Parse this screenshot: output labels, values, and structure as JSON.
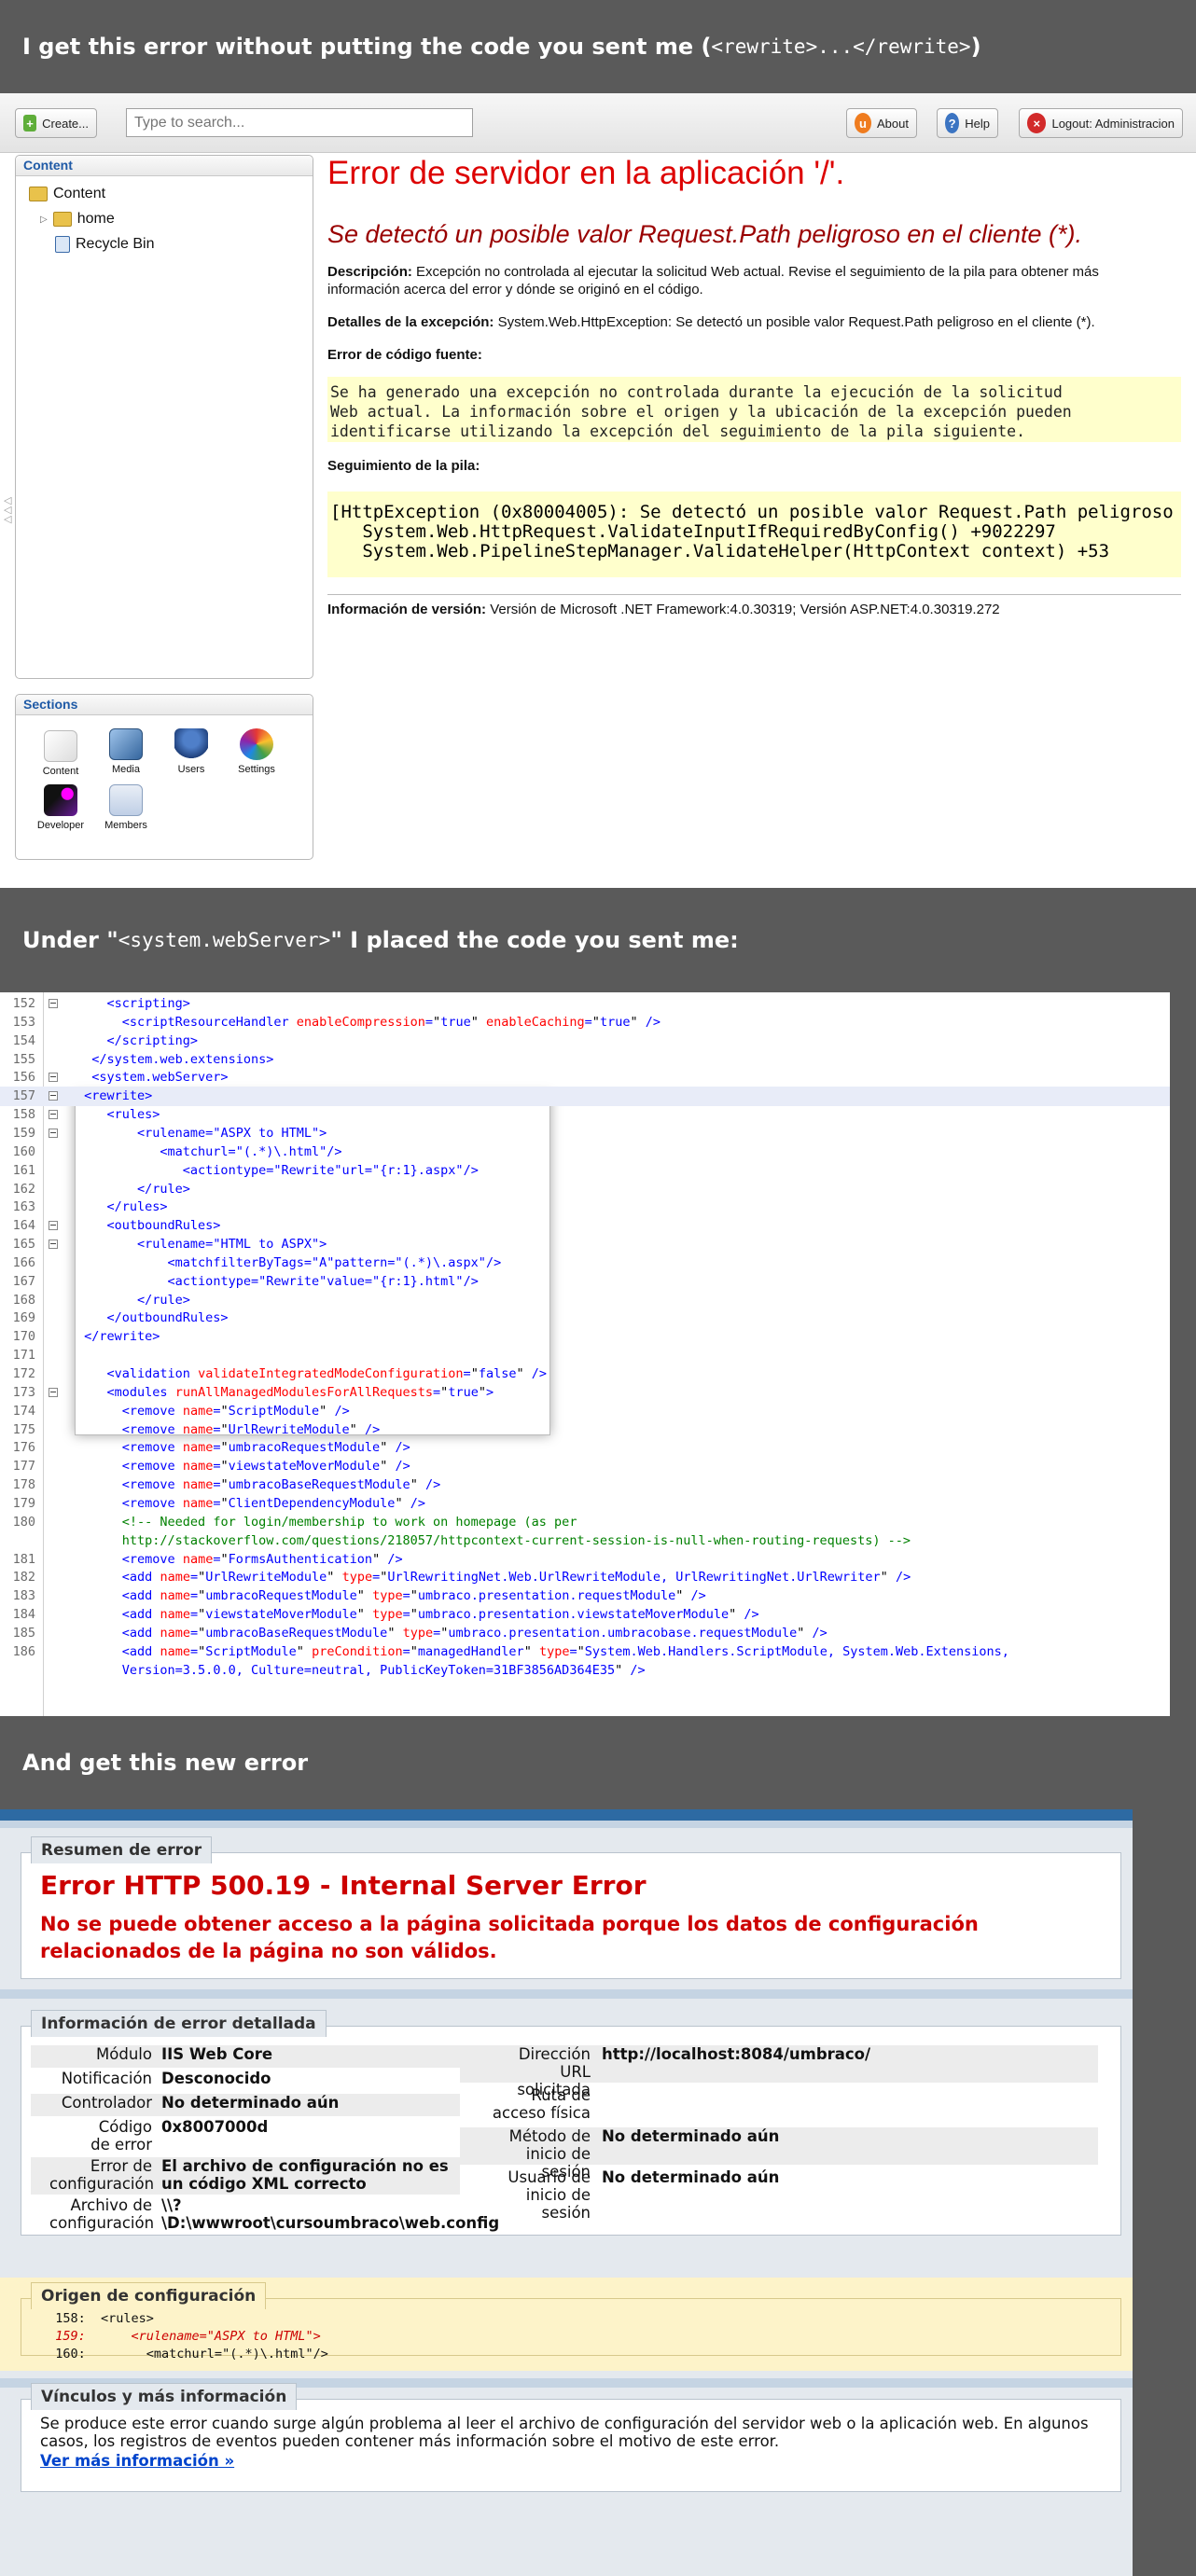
{
  "banners": {
    "b1_pre": "I get this error without putting the code you sent me (",
    "b1_code": "<rewrite>...</rewrite>",
    "b1_post": ")",
    "b2_pre": "Under \"",
    "b2_code": "<system.webServer>",
    "b2_post": "\" I placed the code you sent me:",
    "b3": "And get this new error"
  },
  "umbraco": {
    "create_label": "Create...",
    "search_placeholder": "Type to search...",
    "about_label": "About",
    "help_label": "Help",
    "logout_label": "Logout: Administracion",
    "content_panel_title": "Content",
    "tree": [
      "Content",
      "home",
      "Recycle Bin"
    ],
    "sections_title": "Sections",
    "sections": [
      "Content",
      "Media",
      "Users",
      "Settings",
      "Developer",
      "Members"
    ],
    "error": {
      "title": "Error de servidor en la aplicación '/'.",
      "subtitle": "Se detectó un posible valor Request.Path peligroso en el cliente (*).",
      "desc_label": "Descripción:",
      "desc_text": " Excepción no controlada al ejecutar la solicitud Web actual. Revise el seguimiento de la pila para obtener más información acerca del error y dónde se originó en el código.",
      "exc_label": "Detalles de la excepción:",
      "exc_text": " System.Web.HttpException: Se detectó un posible valor Request.Path peligroso en el cliente (*).",
      "source_label": "Error de código fuente:",
      "source_text": "Se ha generado una excepción no controlada durante la ejecución de la solicitud\nWeb actual. La información sobre el origen y la ubicación de la excepción pueden\nidentificarse utilizando la excepción del seguimiento de la pila siguiente.",
      "stack_label": "Seguimiento de la pila:",
      "stack_text": "[HttpException (0x80004005): Se detectó un posible valor Request.Path peligroso en el cliente (*).]\n   System.Web.HttpRequest.ValidateInputIfRequiredByConfig() +9022297\n   System.Web.PipelineStepManager.ValidateHelper(HttpContext context) +53",
      "version_label": "Información de versión:",
      "version_text": " Versión de Microsoft .NET Framework:4.0.30319; Versión ASP.NET:4.0.30319.272"
    }
  },
  "code_lines": [
    {
      "n": "152",
      "html": "    <span class='t'>&lt;scripting&gt;</span>"
    },
    {
      "n": "153",
      "html": "      <span class='t'>&lt;scriptResourceHandler</span> <span class='a'>enableCompression</span><span class='t'>=</span><span class='k'>\"</span><span class='v'>true</span><span class='k'>\"</span> <span class='a'>enableCaching</span><span class='t'>=</span><span class='k'>\"</span><span class='v'>true</span><span class='k'>\"</span> <span class='t'>/&gt;</span>"
    },
    {
      "n": "154",
      "html": "    <span class='t'>&lt;/scripting&gt;</span>"
    },
    {
      "n": "155",
      "html": "  <span class='t'>&lt;/system.web.extensions&gt;</span>"
    },
    {
      "n": "156",
      "html": "  <span class='t'>&lt;system.webServer&gt;</span>"
    },
    {
      "n": "157",
      "html": " <span class='t'>&lt;rewrite&gt;</span>"
    },
    {
      "n": "158",
      "html": "    <span class='t'>&lt;rules&gt;</span>"
    },
    {
      "n": "159",
      "html": "        <span class='t'>&lt;rulename=</span><span class='v'>\"ASPX to HTML\"</span><span class='t'>&gt;</span>"
    },
    {
      "n": "160",
      "html": "           <span class='t'>&lt;matchurl=</span><span class='v'>\"(.*)\\.html\"</span><span class='t'>/&gt;</span>"
    },
    {
      "n": "161",
      "html": "              <span class='t'>&lt;actiontype=</span><span class='v'>\"Rewrite\"</span><span class='t'>url=</span><span class='v'>\"{r:1}.aspx\"</span><span class='t'>/&gt;</span>"
    },
    {
      "n": "162",
      "html": "        <span class='t'>&lt;/rule&gt;</span>"
    },
    {
      "n": "163",
      "html": "    <span class='t'>&lt;/rules&gt;</span>"
    },
    {
      "n": "164",
      "html": "    <span class='t'>&lt;outboundRules&gt;</span>"
    },
    {
      "n": "165",
      "html": "        <span class='t'>&lt;rulename=</span><span class='v'>\"HTML to ASPX\"</span><span class='t'>&gt;</span>"
    },
    {
      "n": "166",
      "html": "            <span class='t'>&lt;matchfilterByTags=</span><span class='v'>\"A\"</span><span class='t'>pattern=</span><span class='v'>\"(.*)\\.aspx\"</span><span class='t'>/&gt;</span>"
    },
    {
      "n": "167",
      "html": "            <span class='t'>&lt;actiontype=</span><span class='v'>\"Rewrite\"</span><span class='t'>value=</span><span class='v'>\"{r:1}.html\"</span><span class='t'>/&gt;</span>"
    },
    {
      "n": "168",
      "html": "        <span class='t'>&lt;/rule&gt;</span>"
    },
    {
      "n": "169",
      "html": "    <span class='t'>&lt;/outboundRules&gt;</span>"
    },
    {
      "n": "170",
      "html": " <span class='t'>&lt;/rewrite&gt;</span>"
    },
    {
      "n": "171",
      "html": ""
    },
    {
      "n": "172",
      "html": "    <span class='t'>&lt;validation</span> <span class='a'>validateIntegratedModeConfiguration</span><span class='t'>=</span><span class='k'>\"</span><span class='v'>false</span><span class='k'>\"</span> <span class='t'>/&gt;</span>"
    },
    {
      "n": "173",
      "html": "    <span class='t'>&lt;modules</span> <span class='a'>runAllManagedModulesForAllRequests</span><span class='t'>=</span><span class='k'>\"</span><span class='v'>true</span><span class='k'>\"</span><span class='t'>&gt;</span>"
    },
    {
      "n": "174",
      "html": "      <span class='t'>&lt;remove</span> <span class='a'>name</span><span class='t'>=</span><span class='k'>\"</span><span class='v'>ScriptModule</span><span class='k'>\"</span> <span class='t'>/&gt;</span>"
    },
    {
      "n": "175",
      "html": "      <span class='t'>&lt;remove</span> <span class='a'>name</span><span class='t'>=</span><span class='k'>\"</span><span class='v'>UrlRewriteModule</span><span class='k'>\"</span> <span class='t'>/&gt;</span>"
    },
    {
      "n": "176",
      "html": "      <span class='t'>&lt;remove</span> <span class='a'>name</span><span class='t'>=</span><span class='k'>\"</span><span class='v'>umbracoRequestModule</span><span class='k'>\"</span> <span class='t'>/&gt;</span>"
    },
    {
      "n": "177",
      "html": "      <span class='t'>&lt;remove</span> <span class='a'>name</span><span class='t'>=</span><span class='k'>\"</span><span class='v'>viewstateMoverModule</span><span class='k'>\"</span> <span class='t'>/&gt;</span>"
    },
    {
      "n": "178",
      "html": "      <span class='t'>&lt;remove</span> <span class='a'>name</span><span class='t'>=</span><span class='k'>\"</span><span class='v'>umbracoBaseRequestModule</span><span class='k'>\"</span> <span class='t'>/&gt;</span>"
    },
    {
      "n": "179",
      "html": "      <span class='t'>&lt;remove</span> <span class='a'>name</span><span class='t'>=</span><span class='k'>\"</span><span class='v'>ClientDependencyModule</span><span class='k'>\"</span> <span class='t'>/&gt;</span>"
    },
    {
      "n": "180",
      "html": "      <span class='c'>&lt;!-- Needed for login/membership to work on homepage (as per</span>"
    },
    {
      "n": "",
      "html": "      <span class='c'>http://stackoverflow.com/questions/218057/httpcontext-current-session-is-null-when-routing-requests) --&gt;</span>"
    },
    {
      "n": "181",
      "html": "      <span class='t'>&lt;remove</span> <span class='a'>name</span><span class='t'>=</span><span class='k'>\"</span><span class='v'>FormsAuthentication</span><span class='k'>\"</span> <span class='t'>/&gt;</span>"
    },
    {
      "n": "182",
      "html": "      <span class='t'>&lt;add</span> <span class='a'>name</span><span class='t'>=</span><span class='k'>\"</span><span class='v'>UrlRewriteModule</span><span class='k'>\"</span> <span class='a'>type</span><span class='t'>=</span><span class='k'>\"</span><span class='v'>UrlRewritingNet.Web.UrlRewriteModule, UrlRewritingNet.UrlRewriter</span><span class='k'>\"</span> <span class='t'>/&gt;</span>"
    },
    {
      "n": "183",
      "html": "      <span class='t'>&lt;add</span> <span class='a'>name</span><span class='t'>=</span><span class='k'>\"</span><span class='v'>umbracoRequestModule</span><span class='k'>\"</span> <span class='a'>type</span><span class='t'>=</span><span class='k'>\"</span><span class='v'>umbraco.presentation.requestModule</span><span class='k'>\"</span> <span class='t'>/&gt;</span>"
    },
    {
      "n": "184",
      "html": "      <span class='t'>&lt;add</span> <span class='a'>name</span><span class='t'>=</span><span class='k'>\"</span><span class='v'>viewstateMoverModule</span><span class='k'>\"</span> <span class='a'>type</span><span class='t'>=</span><span class='k'>\"</span><span class='v'>umbraco.presentation.viewstateMoverModule</span><span class='k'>\"</span> <span class='t'>/&gt;</span>"
    },
    {
      "n": "185",
      "html": "      <span class='t'>&lt;add</span> <span class='a'>name</span><span class='t'>=</span><span class='k'>\"</span><span class='v'>umbracoBaseRequestModule</span><span class='k'>\"</span> <span class='a'>type</span><span class='t'>=</span><span class='k'>\"</span><span class='v'>umbraco.presentation.umbracobase.requestModule</span><span class='k'>\"</span> <span class='t'>/&gt;</span>"
    },
    {
      "n": "186",
      "html": "      <span class='t'>&lt;add</span> <span class='a'>name</span><span class='t'>=</span><span class='k'>\"</span><span class='v'>ScriptModule</span><span class='k'>\"</span> <span class='a'>preCondition</span><span class='t'>=</span><span class='k'>\"</span><span class='v'>managedHandler</span><span class='k'>\"</span> <span class='a'>type</span><span class='t'>=</span><span class='k'>\"</span><span class='v'>System.Web.Handlers.ScriptModule, System.Web.Extensions,</span>"
    },
    {
      "n": "",
      "html": "      <span class='v'>Version=3.5.0.0, Culture=neutral, PublicKeyToken=31BF3856AD364E35</span><span class='k'>\"</span> <span class='t'>/&gt;</span>"
    }
  ],
  "iis": {
    "summary_label": "Resumen de error",
    "title": "Error HTTP 500.19 - Internal Server Error",
    "subtitle": "No se puede obtener acceso a la página solicitada porque los datos de configuración relacionados de la página no son válidos.",
    "detail_label": "Información de error detallada",
    "left": [
      {
        "k": "Módulo",
        "v": "IIS Web Core"
      },
      {
        "k": "Notificación",
        "v": "Desconocido"
      },
      {
        "k": "Controlador",
        "v": "No determinado aún"
      },
      {
        "k": "Código de error",
        "v": "0x8007000d"
      },
      {
        "k": "Error de configuración",
        "v": "El archivo de configuración no es un código XML correcto"
      },
      {
        "k": "Archivo de configuración",
        "v": "\\\\?\\D:\\wwwroot\\cursoumbraco\\web.config"
      }
    ],
    "right": [
      {
        "k": "Dirección URL solicitada",
        "v": "http://localhost:8084/umbraco/"
      },
      {
        "k": "Ruta de acceso física",
        "v": ""
      },
      {
        "k": "Método de inicio de sesión",
        "v": "No determinado aún"
      },
      {
        "k": "Usuario de inicio de sesión",
        "v": "No determinado aún"
      }
    ],
    "config_label": "Origen de configuración",
    "config_lines": [
      {
        "n": "158:",
        "t": "<rules>",
        "hl": false
      },
      {
        "n": "159:",
        "t": "    <rulename=\"ASPX to HTML\">",
        "hl": true
      },
      {
        "n": "160:",
        "t": "      <matchurl=\"(.*)\\.html\"/>",
        "hl": false
      }
    ],
    "links_label": "Vínculos y más información",
    "links_text": "Se produce este error cuando surge algún problema al leer el archivo de configuración del servidor web o la aplicación web. En algunos casos, los registros de eventos pueden contener más información sobre el motivo de este error.",
    "more_link": "Ver más información »"
  }
}
